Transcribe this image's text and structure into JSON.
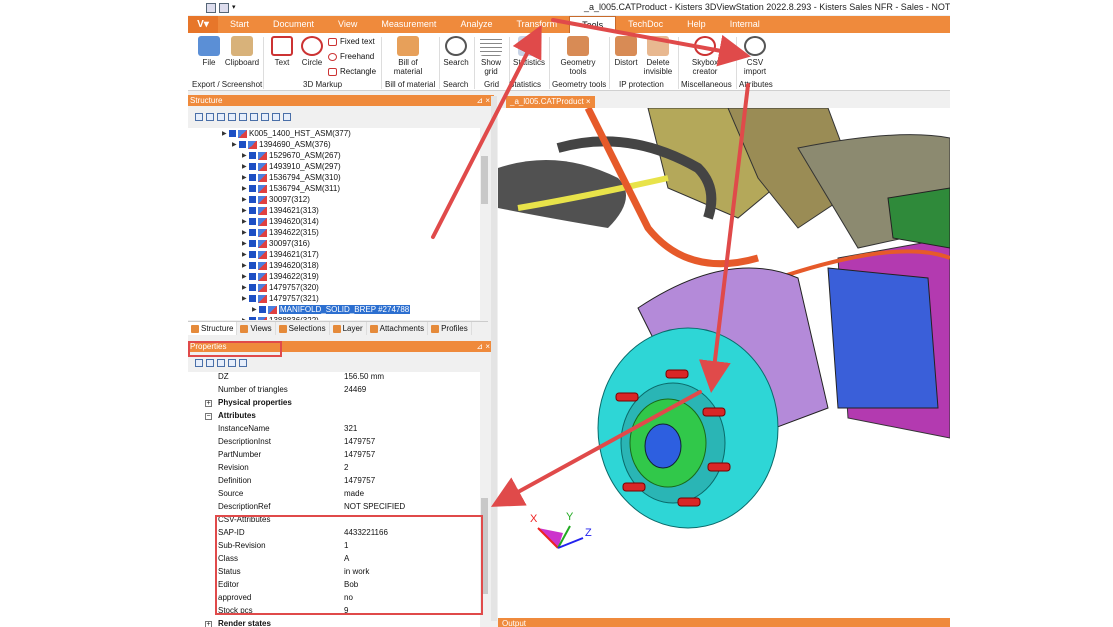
{
  "title": "_a_l005.CATProduct - Kisters 3DViewStation 2022.8.293 - Kisters Sales NFR - Sales - NOT",
  "logo": "V",
  "menu_tabs": [
    "Start",
    "Document",
    "View",
    "Measurement",
    "Analyze",
    "Transform",
    "Tools",
    "TechDoc",
    "Help",
    "Internal"
  ],
  "active_tab": "Tools",
  "ribbon": {
    "file": "File",
    "clipboard": "Clipboard",
    "text": "Text",
    "circle": "Circle",
    "fixed_text": "Fixed text",
    "freehand": "Freehand",
    "rectangle": "Rectangle",
    "bom": "Bill of material",
    "search": "Search",
    "show_grid": "Show grid",
    "statistics": "Statistics",
    "geometry_tools": "Geometry tools",
    "distort": "Distort",
    "delete_invisible": "Delete invisible",
    "skybox": "Skybox creator",
    "csv_import": "CSV import",
    "groups": {
      "export": "Export / Screenshot",
      "markup": "3D Markup",
      "bom": "Bill of material",
      "search": "Search",
      "grid": "Grid",
      "statistics": "Statistics",
      "geometry": "Geometry tools",
      "ip": "IP protection",
      "misc": "Miscellaneous",
      "attributes": "Attributes"
    }
  },
  "structure": {
    "header": "Structure",
    "rows": [
      {
        "label": "K005_1400_HST_ASM(377)",
        "indent": 0
      },
      {
        "label": "1394690_ASM(376)",
        "indent": 1
      },
      {
        "label": "1529670_ASM(267)",
        "indent": 2
      },
      {
        "label": "1493910_ASM(297)",
        "indent": 2
      },
      {
        "label": "1536794_ASM(310)",
        "indent": 2
      },
      {
        "label": "1536794_ASM(311)",
        "indent": 2
      },
      {
        "label": "30097(312)",
        "indent": 2
      },
      {
        "label": "1394621(313)",
        "indent": 2
      },
      {
        "label": "1394620(314)",
        "indent": 2
      },
      {
        "label": "1394622(315)",
        "indent": 2
      },
      {
        "label": "30097(316)",
        "indent": 2
      },
      {
        "label": "1394621(317)",
        "indent": 2
      },
      {
        "label": "1394620(318)",
        "indent": 2
      },
      {
        "label": "1394622(319)",
        "indent": 2
      },
      {
        "label": "1479757(320)",
        "indent": 2
      },
      {
        "label": "1479757(321)",
        "indent": 2
      },
      {
        "label": "MANIFOLD_SOLID_BREP #274788",
        "indent": 3
      },
      {
        "label": "1388836(322)",
        "indent": 2
      }
    ],
    "selected_index": 16,
    "tabs": [
      "Structure",
      "Views",
      "Selections",
      "Layer",
      "Attachments",
      "Profiles"
    ]
  },
  "properties": {
    "header": "Properties",
    "rows": [
      {
        "key": "DZ",
        "value": "156.50 mm"
      },
      {
        "key": "Number of triangles",
        "value": "24469"
      },
      {
        "key": "Physical properties",
        "value": "",
        "category": true,
        "expander": "+"
      },
      {
        "key": "Attributes",
        "value": "",
        "category": true,
        "expander": "−"
      },
      {
        "key": "InstanceName",
        "value": "321"
      },
      {
        "key": "DescriptionInst",
        "value": "1479757"
      },
      {
        "key": "PartNumber",
        "value": "1479757"
      },
      {
        "key": "Revision",
        "value": "2"
      },
      {
        "key": "Definition",
        "value": "1479757"
      },
      {
        "key": "Source",
        "value": "made"
      },
      {
        "key": "DescriptionRef",
        "value": "NOT SPECIFIED"
      },
      {
        "key": "CSV-Attributes",
        "value": ""
      },
      {
        "key": "SAP-ID",
        "value": "4433221166"
      },
      {
        "key": "Sub-Revision",
        "value": "1"
      },
      {
        "key": "Class",
        "value": "A"
      },
      {
        "key": "Status",
        "value": "in work"
      },
      {
        "key": "Editor",
        "value": "Bob"
      },
      {
        "key": "approved",
        "value": "no"
      },
      {
        "key": "Stock pcs",
        "value": "9"
      },
      {
        "key": "Render states",
        "value": "",
        "category": true,
        "expander": "+"
      }
    ]
  },
  "document_tab": "_a_l005.CATProduct",
  "output_label": "Output",
  "axes": {
    "x": "X",
    "y": "Y",
    "z": "Z"
  },
  "colors": {
    "accent": "#ef8a3c",
    "annotation": "#e04a4a",
    "selection": "#2c6fd0"
  }
}
